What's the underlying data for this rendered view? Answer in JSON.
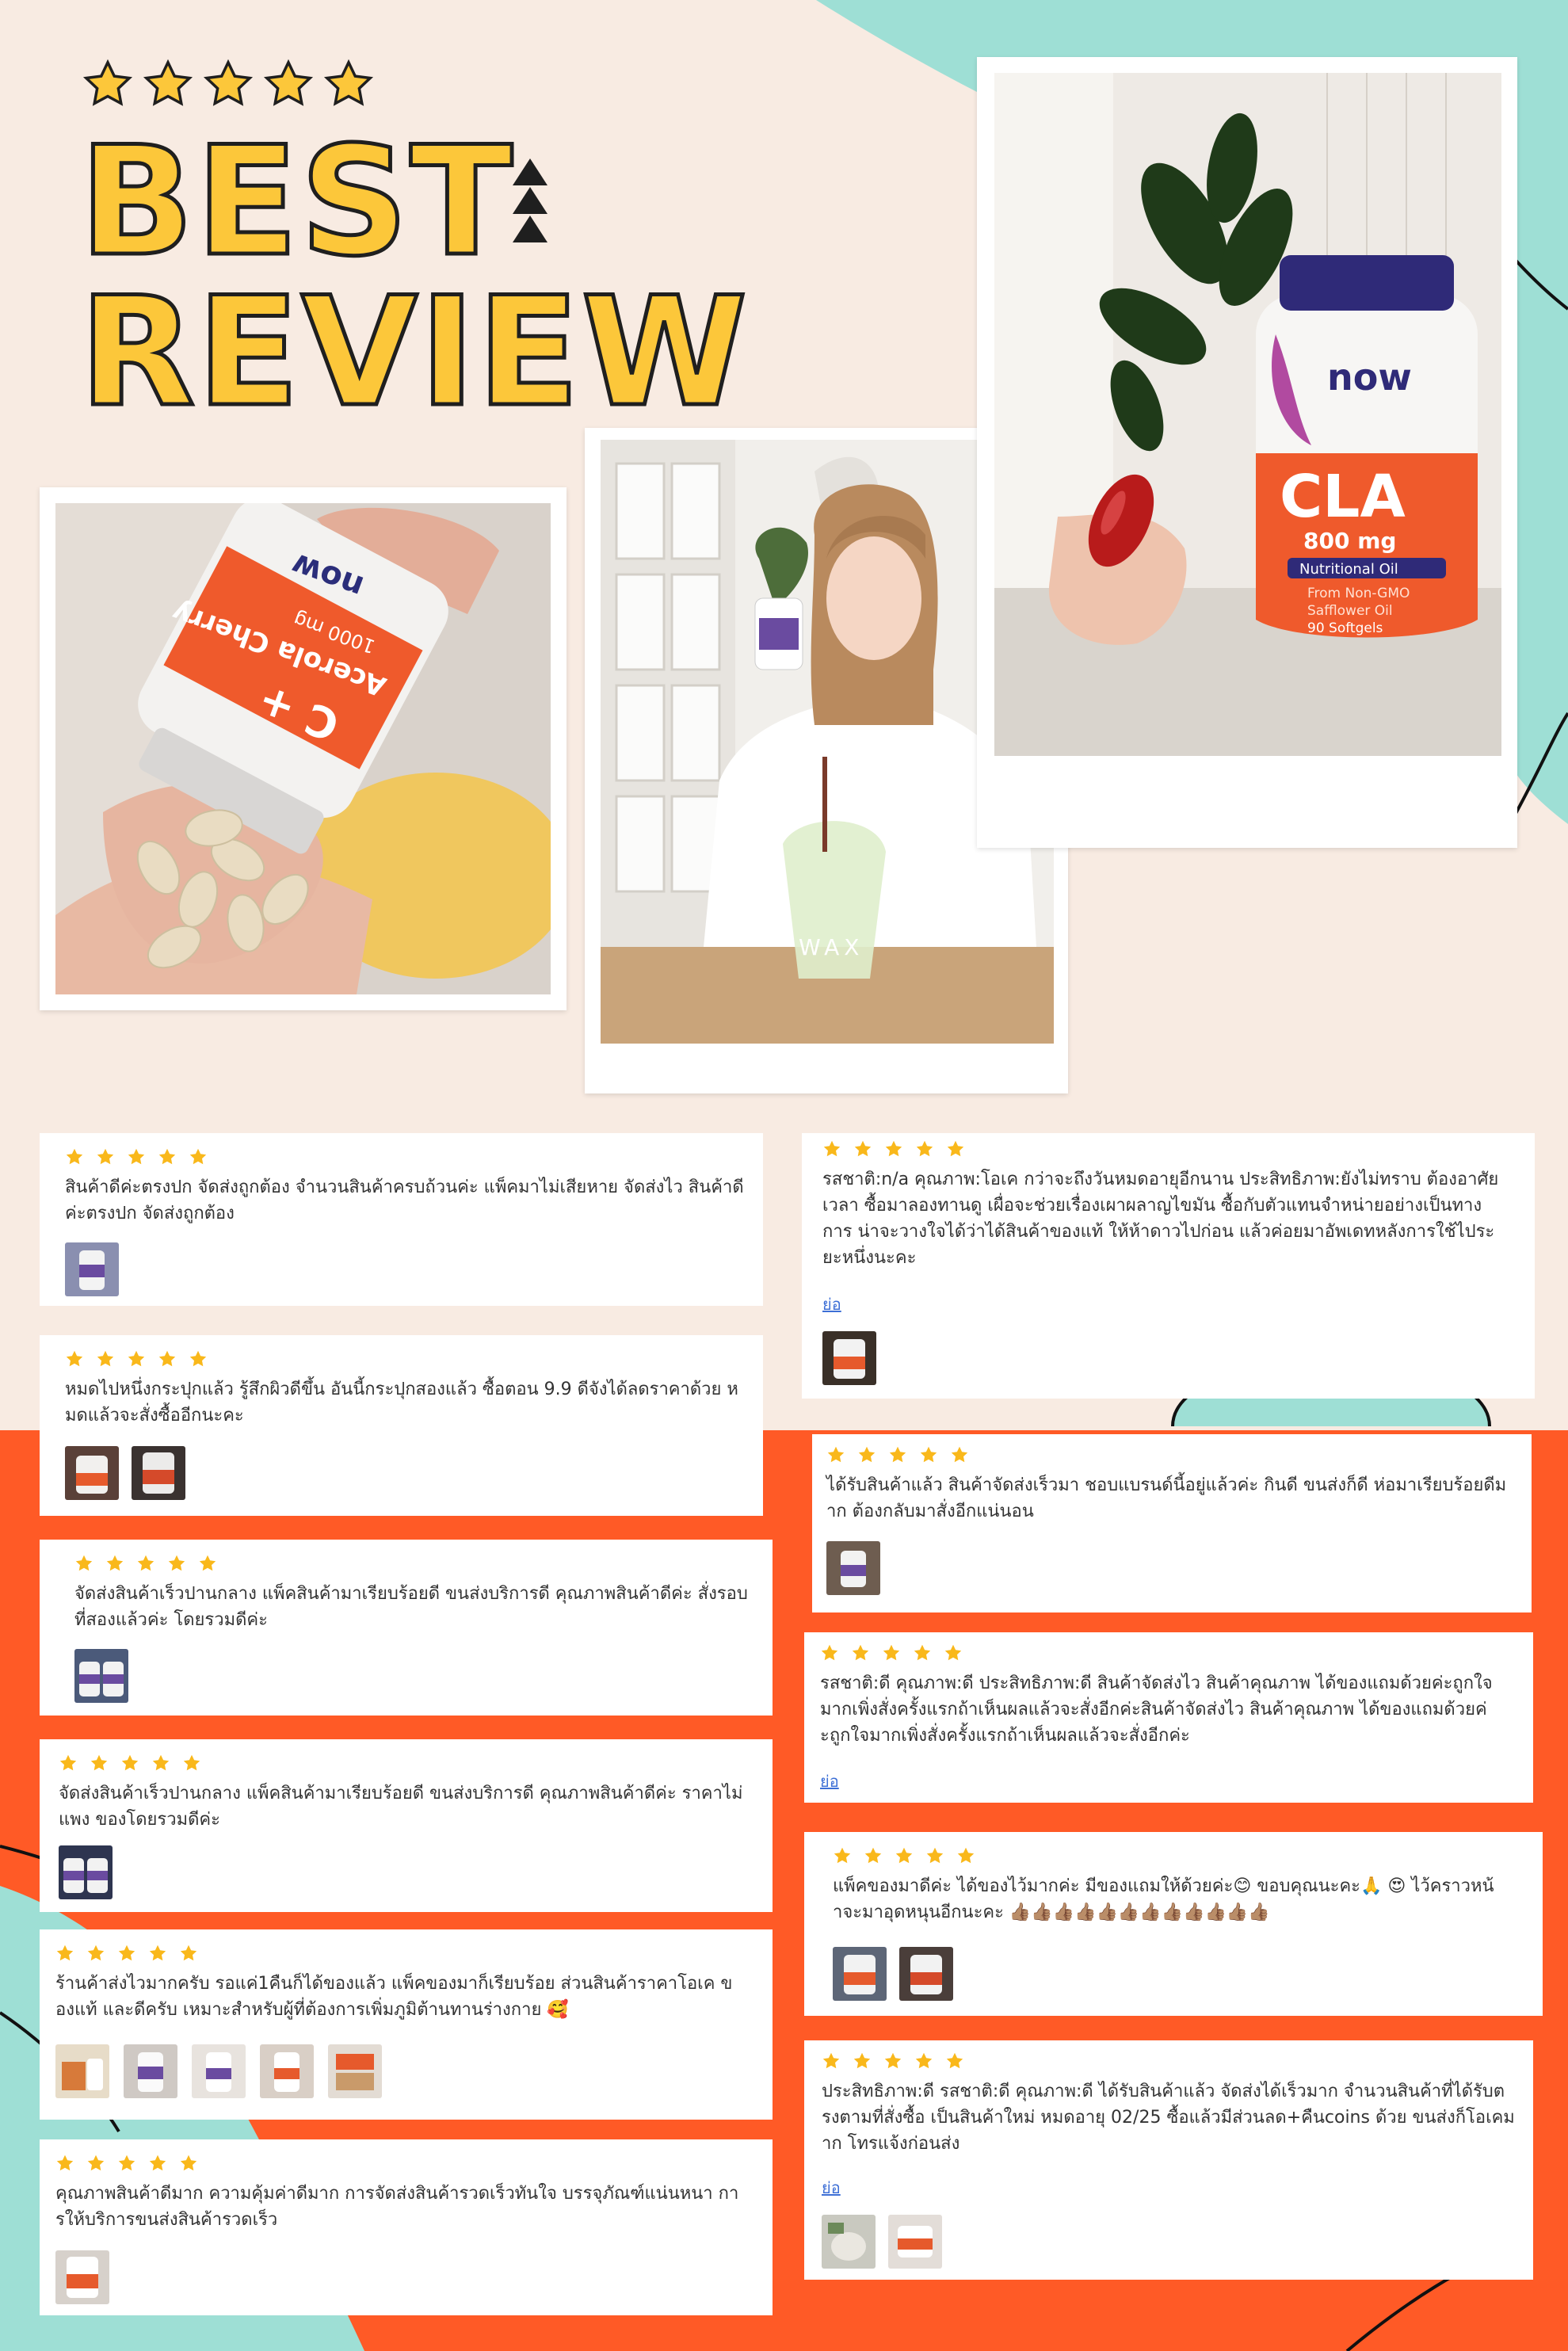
{
  "header": {
    "line1": "BEST",
    "line2": "REVIEW",
    "stars": 5
  },
  "colors": {
    "background": "#f8ebe2",
    "mint": "#9edfd5",
    "orange": "#ff5a26",
    "headline_fill": "#fcc73a",
    "headline_outline": "#1f1f1f",
    "star": "#f9b81b",
    "link": "#3d6fd6"
  },
  "photos": [
    {
      "name": "acerola-cherry-bottle",
      "label_brand": "now",
      "label_line1": "C +",
      "label_line2": "Acerola Cherry",
      "label_line3": "1000 mg"
    },
    {
      "name": "woman-holding-bottle",
      "cup_text": "WAX"
    },
    {
      "name": "cla-bottle",
      "label_brand": "now",
      "label_line1": "CLA",
      "label_line2": "800 mg",
      "label_line3": "Nutritional Oil",
      "label_line4": "From Non-GMO",
      "label_line5": "Safflower Oil",
      "label_line6": "90 Softgels"
    }
  ],
  "reviews": [
    {
      "rating": 5,
      "text": "สินค้าดีค่ะตรงปก จัดส่งถูกต้อง จำนวนสินค้าครบถ้วนค่ะ แพ็คมาไม่เสียหาย จัดส่งไว สินค้าดี\nค่ะตรงปก จัดส่งถูกต้อง",
      "more": "",
      "thumbs": 1
    },
    {
      "rating": 5,
      "text": "หมดไปหนึ่งกระปุกแล้ว รู้สึกผิวดีขึ้น อันนี้กระปุกสองแล้ว ซื้อตอน 9.9 ดีจังได้ลดราคาด้วย ห\nมดแล้วจะสั่งซื้ออีกนะคะ",
      "more": "",
      "thumbs": 2
    },
    {
      "rating": 5,
      "text": "จัดส่งสินค้าเร็วปานกลาง แพ็คสินค้ามาเรียบร้อยดี ขนส่งบริการดี คุณภาพสินค้าดีค่ะ สั่งรอบ\nที่สองแล้วค่ะ โดยรวมดีค่ะ",
      "more": "",
      "thumbs": 1
    },
    {
      "rating": 5,
      "text": "จัดส่งสินค้าเร็วปานกลาง แพ็คสินค้ามาเรียบร้อยดี ขนส่งบริการดี คุณภาพสินค้าดีค่ะ ราคาไม่\nแพง ของโดยรวมดีค่ะ",
      "more": "",
      "thumbs": 1
    },
    {
      "rating": 5,
      "text": "ร้านค้าส่งไวมากครับ รอแค่1คืนก็ได้ของแล้ว แพ็คของมาก็เรียบร้อย ส่วนสินค้าราคาโอเค ข\nองแท้ และดีครับ เหมาะสำหรับผู้ที่ต้องการเพิ่มภูมิต้านทานร่างกาย 🥰",
      "more": "",
      "thumbs": 5
    },
    {
      "rating": 5,
      "text": "คุณภาพสินค้าดีมาก ความคุ้มค่าดีมาก การจัดส่งสินค้ารวดเร็วทันใจ บรรจุภัณฑ์แน่นหนา กา\nรให้บริการขนส่งสินค้ารวดเร็ว",
      "more": "",
      "thumbs": 1
    },
    {
      "rating": 5,
      "text": "รสชาติ:n/a คุณภาพ:โอเค กว่าจะถึงวันหมดอายุอีกนาน ประสิทธิภาพ:ยังไม่ทราบ ต้องอาศัย\nเวลา ซื้อมาลองทานดู เผื่อจะช่วยเรื่องเผาผลาญไขมัน ซื้อกับตัวแทนจำหน่ายอย่างเป็นทาง\nการ น่าจะวางใจได้ว่าได้สินค้าของแท้ ให้ห้าดาวไปก่อน แล้วค่อยมาอัพเดทหลังการใช้ไประ\nยะหนึ่งนะคะ",
      "more": "ย่อ",
      "thumbs": 1
    },
    {
      "rating": 5,
      "text": "ได้รับสินค้าแล้ว สินค้าจัดส่งเร็วมา ชอบแบรนด์นี้อยู่แล้วค่ะ กินดี ขนส่งก็ดี ห่อมาเรียบร้อยดีม\nาก ต้องกลับมาสั่งอีกแน่นอน",
      "more": "",
      "thumbs": 1
    },
    {
      "rating": 5,
      "text": "รสชาติ:ดี คุณภาพ:ดี ประสิทธิภาพ:ดี สินค้าจัดส่งไว สินค้าคุณภาพ ได้ของแถมด้วยค่ะถูกใจ\nมากเพิ่งสั่งครั้งแรกถ้าเห็นผลแล้วจะสั่งอีกค่ะสินค้าจัดส่งไว สินค้าคุณภาพ ได้ของแถมด้วยค่\nะถูกใจมากเพิ่งสั่งครั้งแรกถ้าเห็นผลแล้วจะสั่งอีกค่ะ",
      "more": "ย่อ",
      "thumbs": 0
    },
    {
      "rating": 5,
      "text": "แพ็คของมาดีค่ะ ได้ของไว้มากค่ะ มีของแถมให้ด้วยค่ะ😊 ขอบคุณนะคะ🙏 😍 ไว้คราวหน้\nาจะมาอุดหนุนอีกนะคะ 👍🏽👍🏽👍🏽👍🏽👍🏽👍🏽👍🏽👍🏽👍🏽👍🏽👍🏽👍🏽",
      "more": "",
      "thumbs": 2
    },
    {
      "rating": 5,
      "text": "ประสิทธิภาพ:ดี รสชาติ:ดี คุณภาพ:ดี ได้รับสินค้าแล้ว จัดส่งได้เร็วมาก จำนวนสินค้าที่ได้รับต\nรงตามที่สั่งซื้อ เป็นสินค้าใหม่ หมดอายุ 02/25 ซื้อแล้วมีส่วนลด+คืนcoins ด้วย ขนส่งก็โอเคม\nาก โทรแจ้งก่อนส่ง",
      "more": "ย่อ",
      "thumbs": 2
    }
  ]
}
